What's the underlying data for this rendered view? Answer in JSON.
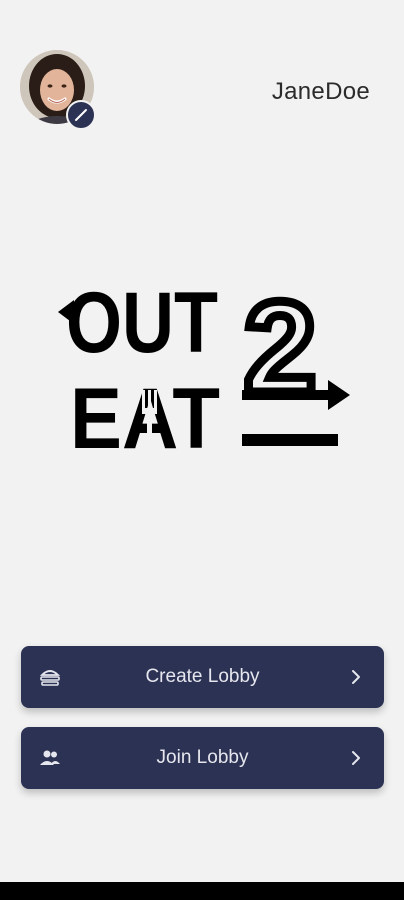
{
  "user": {
    "username": "JaneDoe",
    "avatar": "user-avatar-photo",
    "edit_icon": "pencil-icon"
  },
  "logo": {
    "line1": "OUT",
    "line2": "EAT",
    "numeral": "2"
  },
  "actions": [
    {
      "label": "Create Lobby",
      "icon": "burger-icon",
      "chevron": "chevron-right-icon"
    },
    {
      "label": "Join Lobby",
      "icon": "group-icon",
      "chevron": "chevron-right-icon"
    }
  ],
  "colors": {
    "background": "#f2f2f2",
    "button": "#2c3254",
    "button_text": "#e6e7ee",
    "logo": "#000000"
  }
}
